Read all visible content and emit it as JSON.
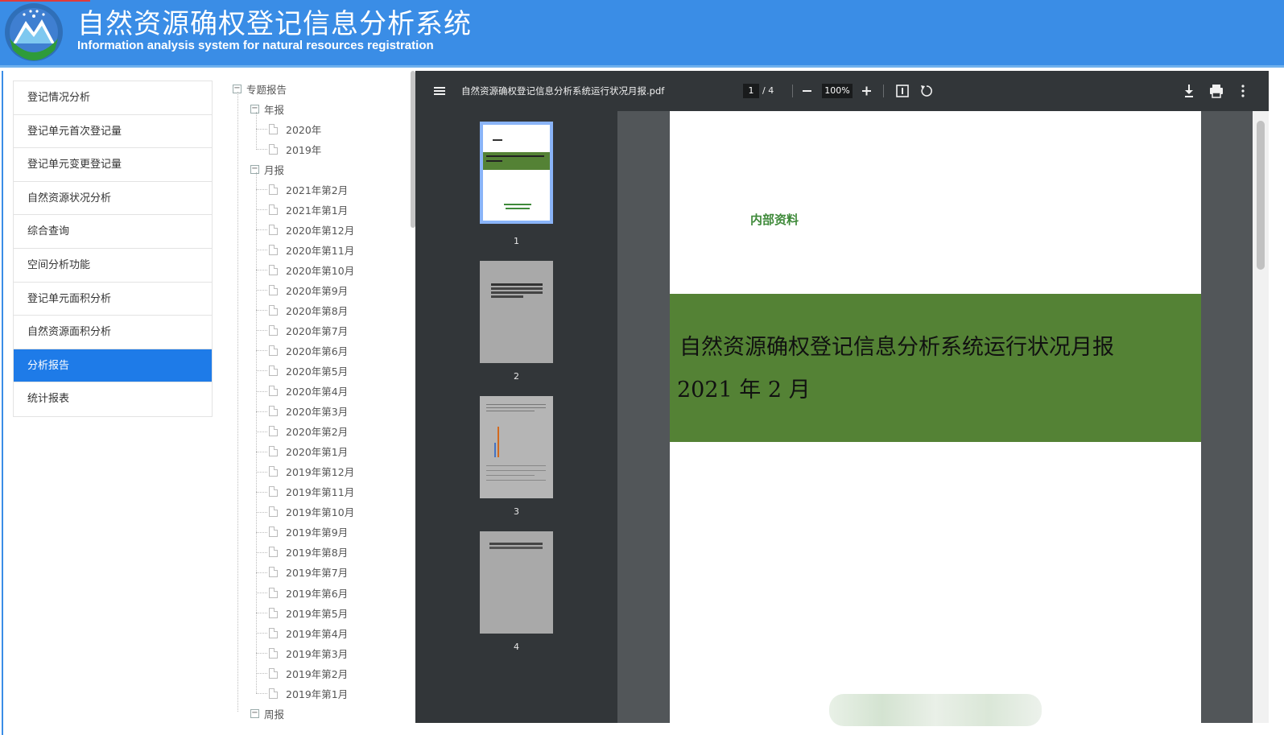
{
  "header": {
    "title": "自然资源确权登记信息分析系统",
    "subtitle": "Information analysis system for natural resources registration"
  },
  "menu": [
    {
      "label": "登记情况分析",
      "active": false
    },
    {
      "label": "登记单元首次登记量",
      "active": false
    },
    {
      "label": "登记单元变更登记量",
      "active": false
    },
    {
      "label": "自然资源状况分析",
      "active": false
    },
    {
      "label": "综合查询",
      "active": false
    },
    {
      "label": "空间分析功能",
      "active": false
    },
    {
      "label": "登记单元面积分析",
      "active": false
    },
    {
      "label": "自然资源面积分析",
      "active": false
    },
    {
      "label": "分析报告",
      "active": true
    },
    {
      "label": "统计报表",
      "active": false
    }
  ],
  "tree": {
    "root": "专题报告",
    "yearly": {
      "label": "年报",
      "children": [
        "2020年",
        "2019年"
      ]
    },
    "monthly": {
      "label": "月报",
      "children": [
        "2021年第2月",
        "2021年第1月",
        "2020年第12月",
        "2020年第11月",
        "2020年第10月",
        "2020年第9月",
        "2020年第8月",
        "2020年第7月",
        "2020年第6月",
        "2020年第5月",
        "2020年第4月",
        "2020年第3月",
        "2020年第2月",
        "2020年第1月",
        "2019年第12月",
        "2019年第11月",
        "2019年第10月",
        "2019年第9月",
        "2019年第8月",
        "2019年第7月",
        "2019年第6月",
        "2019年第5月",
        "2019年第4月",
        "2019年第3月",
        "2019年第2月",
        "2019年第1月"
      ]
    },
    "partial": "周报"
  },
  "pdf": {
    "filename": "自然资源确权登记信息分析系统运行状况月报.pdf",
    "current_page": "1",
    "total_pages": "/ 4",
    "zoom": "100%",
    "thumbs": [
      "1",
      "2",
      "3",
      "4"
    ],
    "page_label": "内部资料",
    "page_title": "自然资源确权登记信息分析系统运行状况月报",
    "page_date": "2021 年 2 月"
  },
  "colors": {
    "header_bg": "#3a8de6",
    "active_menu": "#1e7be8",
    "pdf_band": "#548235",
    "pdf_toolbar": "#323639"
  }
}
